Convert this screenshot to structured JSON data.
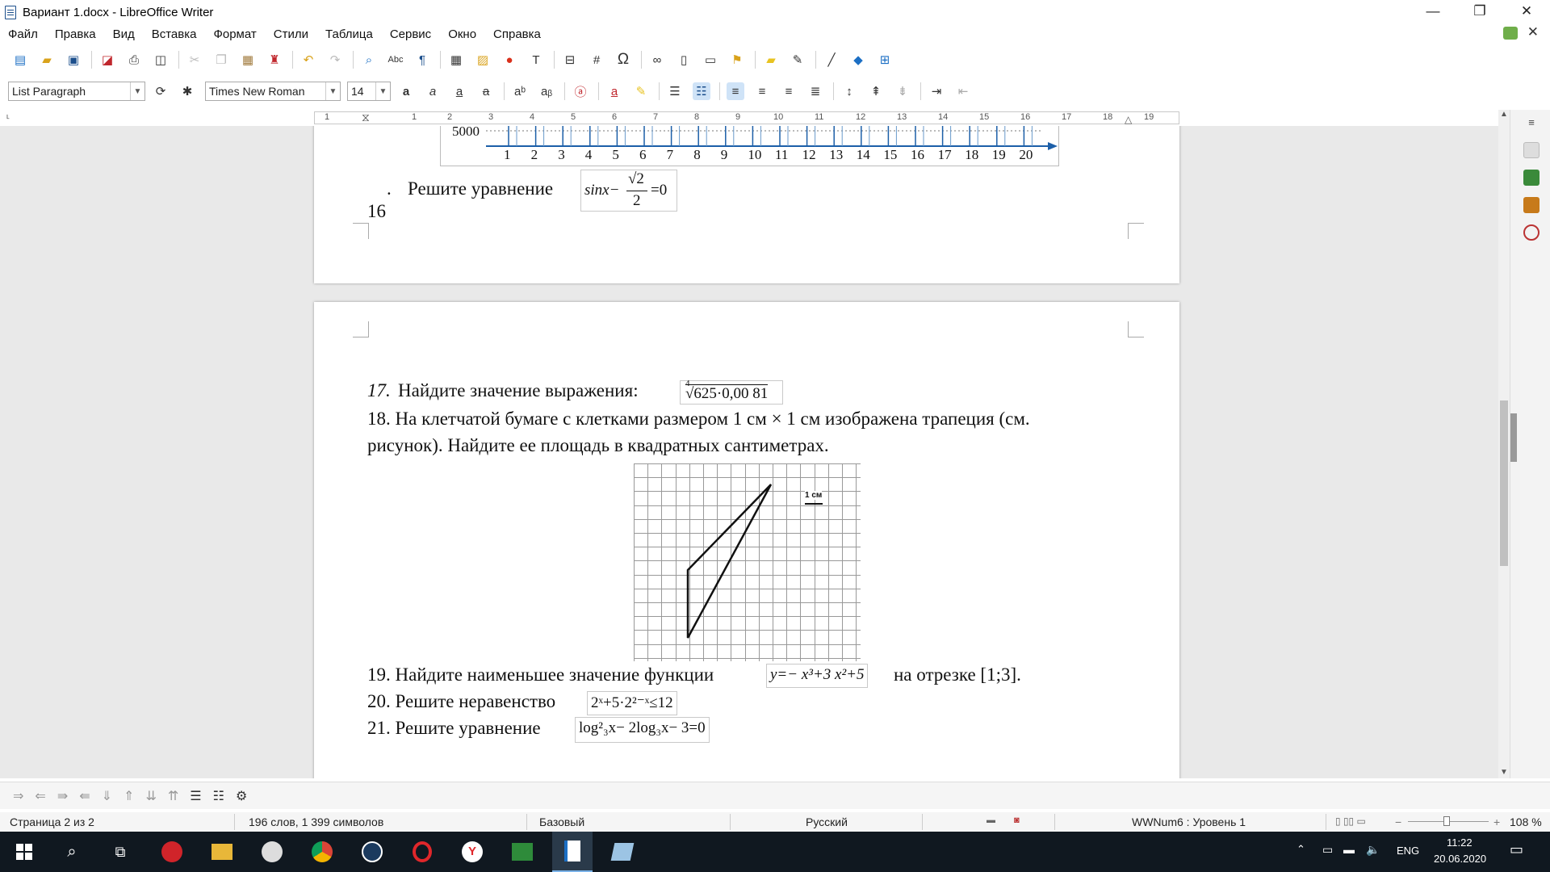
{
  "window": {
    "title": "Вариант 1.docx - LibreOffice Writer",
    "minimize": "—",
    "maximize": "❐",
    "close": "✕"
  },
  "menu": [
    "Файл",
    "Правка",
    "Вид",
    "Вставка",
    "Формат",
    "Стили",
    "Таблица",
    "Сервис",
    "Окно",
    "Справка"
  ],
  "toolbar": {
    "paragraph_style": "List Paragraph",
    "font_name": "Times New Roman",
    "font_size": "14"
  },
  "ruler": {
    "labels": [
      "1",
      "1",
      "2",
      "3",
      "4",
      "5",
      "6",
      "7",
      "8",
      "9",
      "10",
      "11",
      "12",
      "13",
      "14",
      "15",
      "16",
      "17",
      "18",
      "19"
    ]
  },
  "page1": {
    "axis_value": "5000",
    "axis_numbers": [
      "1",
      "2",
      "3",
      "4",
      "5",
      "6",
      "7",
      "8",
      "9",
      "10",
      "11",
      "12",
      "13",
      "14",
      "15",
      "16",
      "17",
      "18",
      "19",
      "20"
    ],
    "task16_num_a": ".",
    "task16_num_b": "16",
    "task16_text": "Решите уравнение",
    "task16_formula_left": "sinx−",
    "task16_formula_num": "√2",
    "task16_formula_den": "2",
    "task16_formula_right": "=0"
  },
  "page2": {
    "task17_num": "17.",
    "task17_text": "Найдите значение выражения:",
    "task17_formula_index": "4",
    "task17_formula": "√625·0,00 81",
    "task18_line1": "18. На клетчатой бумаге с клетками размером 1 см × 1 см изображена трапеция (см.",
    "task18_line2": "рисунок). Найдите ее площадь в квадратных сантиметрах.",
    "grid_scale_label": "1 см",
    "task19_text": "19. Найдите наименьшее значение функции",
    "task19_formula": "y=− x³+3 x²+5",
    "task19_tail": "на отрезке [1;3].",
    "task20_text": "20. Решите неравенство",
    "task20_formula": "2ˣ+5·2²⁻ˣ≤12",
    "task21_text": "21.  Решите уравнение",
    "task21_formula": "log²₃x− 2log₃x− 3=0"
  },
  "status": {
    "page": "Страница 2 из 2",
    "words": "196 слов, 1 399 символов",
    "page_style": "Базовый",
    "language": "Русский",
    "list_level": "WWNum6 : Уровень 1",
    "zoom": "108 %"
  },
  "taskbar": {
    "language": "ENG",
    "time": "11:22",
    "date": "20.06.2020"
  },
  "colors": {
    "accent": "#1c6fc4",
    "taskbar": "#101820"
  }
}
